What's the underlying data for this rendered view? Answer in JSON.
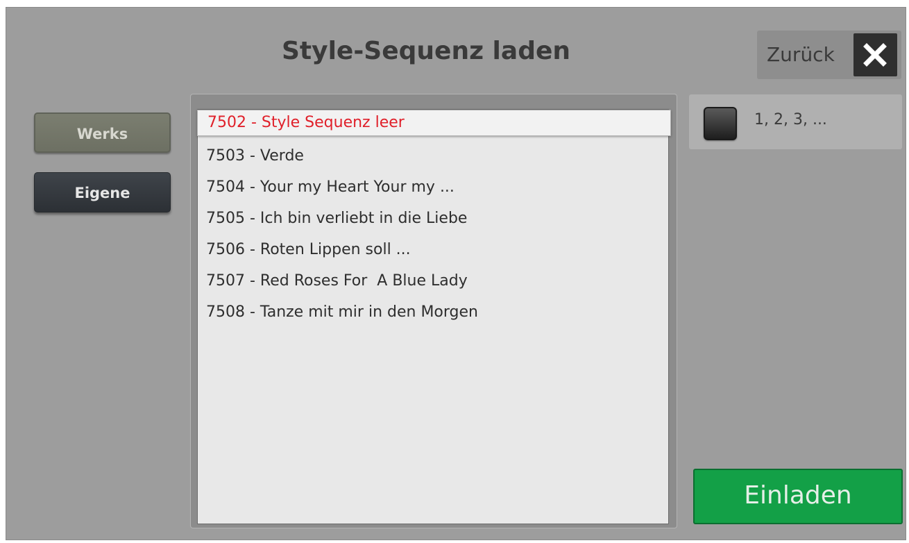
{
  "header": {
    "title": "Style-Sequenz laden",
    "back_label": "Zurück",
    "close_icon": "close-icon"
  },
  "sidebar": {
    "buttons": [
      {
        "label": "Werks",
        "active": true
      },
      {
        "label": "Eigene",
        "active": false
      }
    ]
  },
  "list": {
    "selected_index": 0,
    "items": [
      "7502 - Style Sequenz leer",
      "7503 - Verde",
      "7504 - Your my Heart Your my ...",
      "7505 - Ich bin verliebt in die Liebe",
      "7506 - Roten Lippen soll ...",
      "7507 - Red Roses For  A Blue Lady",
      "7508 - Tanze mit mir in den Morgen"
    ]
  },
  "numbering": {
    "label": "1, 2, 3, ...",
    "checked": false
  },
  "actions": {
    "load_label": "Einladen"
  },
  "colors": {
    "background": "#9d9d9d",
    "selected_text": "#e0202a",
    "load_button": "#13a047",
    "werks_button": "#72756a",
    "eigene_button": "#33373c"
  }
}
